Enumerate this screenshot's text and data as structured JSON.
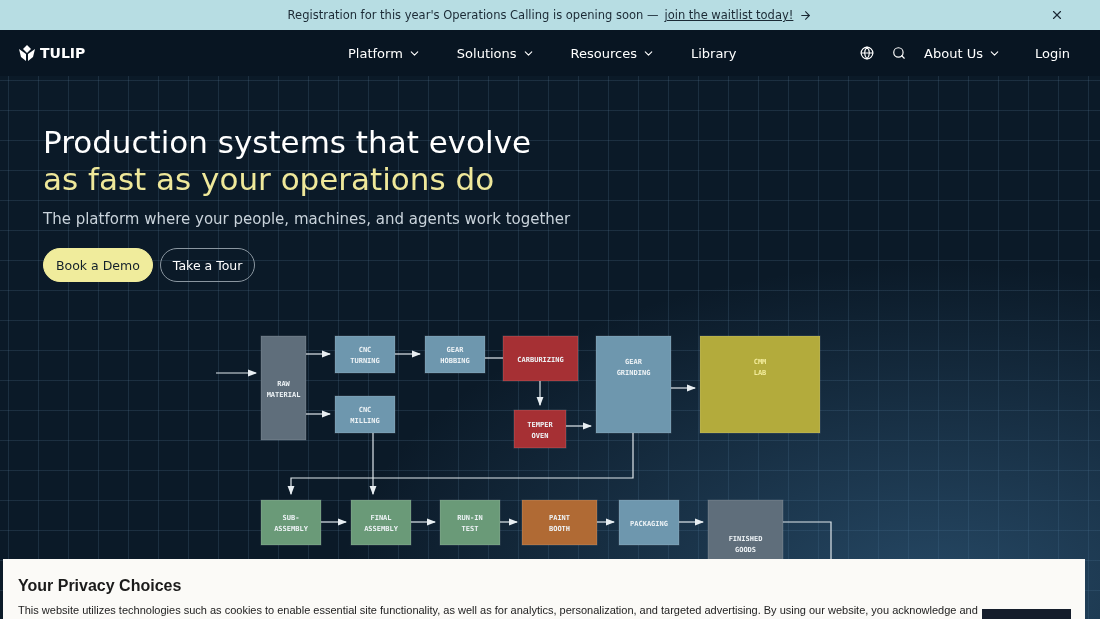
{
  "banner": {
    "text": "Registration for this year's Operations Calling is opening soon —",
    "link": "join the waitlist today!"
  },
  "nav": {
    "brand": "TULIP",
    "items": [
      {
        "label": "Platform",
        "dropdown": true
      },
      {
        "label": "Solutions",
        "dropdown": true
      },
      {
        "label": "Resources",
        "dropdown": true
      },
      {
        "label": "Library",
        "dropdown": false
      }
    ],
    "right_items": [
      {
        "label": "About Us",
        "dropdown": true
      },
      {
        "label": "Login",
        "dropdown": false
      }
    ]
  },
  "hero": {
    "headline": "Production systems that evolve",
    "headline_accent": "as fast as your operations do",
    "subtitle": "The platform where your people, machines, and agents work together",
    "buttons": [
      {
        "label": "Book a Demo",
        "kind": "primary"
      },
      {
        "label": "Take a Tour",
        "kind": "outline"
      }
    ]
  },
  "diagram": {
    "nodes": [
      {
        "lines": [
          "RAW",
          "MATERIAL"
        ],
        "color": "#5f6e7b"
      },
      {
        "lines": [
          "CNC",
          "TURNING"
        ],
        "color": "#6e97ae"
      },
      {
        "lines": [
          "CNC",
          "MILLING"
        ],
        "color": "#6e97ae"
      },
      {
        "lines": [
          "GEAR",
          "HOBBING"
        ],
        "color": "#6e97ae"
      },
      {
        "lines": [
          "CARBURIZING"
        ],
        "color": "#a63034"
      },
      {
        "lines": [
          "TEMPER",
          "OVEN"
        ],
        "color": "#a63034"
      },
      {
        "lines": [
          "GEAR",
          "GRINDING"
        ],
        "color": "#6e97ae"
      },
      {
        "lines": [
          "CMM",
          "LAB"
        ],
        "color": "#b3ab3c"
      },
      {
        "lines": [
          "SUB-",
          "ASSEMBLY"
        ],
        "color": "#6a9a78"
      },
      {
        "lines": [
          "FINAL",
          "ASSEMBLY"
        ],
        "color": "#6a9a78"
      },
      {
        "lines": [
          "RUN-IN",
          "TEST"
        ],
        "color": "#6a9a78"
      },
      {
        "lines": [
          "PAINT",
          "BOOTH"
        ],
        "color": "#b06a34"
      },
      {
        "lines": [
          "PACKAGING"
        ],
        "color": "#6e97ae"
      },
      {
        "lines": [
          "FINISHED",
          "GOODS"
        ],
        "color": "#5f6e7b"
      }
    ]
  },
  "privacy": {
    "title": "Your Privacy Choices",
    "text": "This website utilizes technologies such as cookies to enable essential site functionality, as well as for analytics, personalization, and targeted advertising. By using our website, you acknowledge and"
  }
}
